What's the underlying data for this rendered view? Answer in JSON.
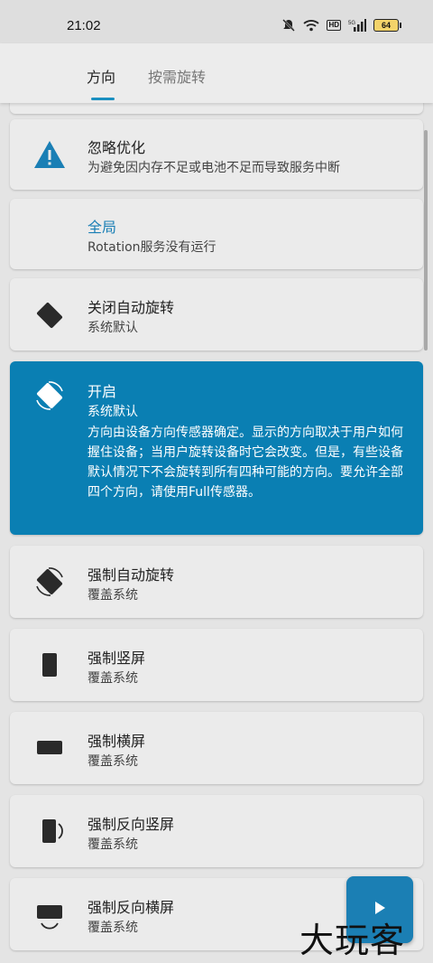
{
  "status_bar": {
    "time": "21:02",
    "battery": "64",
    "hd_badge": "HD",
    "icons": [
      "mute-icon",
      "wifi-icon",
      "hd-icon",
      "signal-icon",
      "battery-icon"
    ]
  },
  "tabs": [
    {
      "label": "方向",
      "active": true
    },
    {
      "label": "按需旋转",
      "active": false
    }
  ],
  "colors": {
    "accent": "#0a7fb3",
    "card_bg": "#ebebeb",
    "page_bg": "#e4e4e4",
    "warning_icon": "#1a7fb5"
  },
  "cards": [
    {
      "icon": "warning-icon",
      "title": "忽略优化",
      "subtitle": "为避免因内存不足或电池不足而导致服务中断"
    },
    {
      "icon": "",
      "title": "全局",
      "subtitle": "Rotation服务没有运行"
    },
    {
      "icon": "rotate-off-icon",
      "title": "关闭自动旋转",
      "subtitle": "系统默认"
    },
    {
      "icon": "rotate-on-icon",
      "title": "开启",
      "subtitle": "系统默认",
      "description": "方向由设备方向传感器确定。显示的方向取决于用户如何握住设备；当用户旋转设备时它会改变。但是，有些设备默认情况下不会旋转到所有四种可能的方向。要允许全部四个方向，请使用Full传感器。",
      "selected": true
    },
    {
      "icon": "force-auto-rotate-icon",
      "title": "强制自动旋转",
      "subtitle": "覆盖系统"
    },
    {
      "icon": "portrait-icon",
      "title": "强制竖屏",
      "subtitle": "覆盖系统"
    },
    {
      "icon": "landscape-icon",
      "title": "强制横屏",
      "subtitle": "覆盖系统"
    },
    {
      "icon": "reverse-portrait-icon",
      "title": "强制反向竖屏",
      "subtitle": "覆盖系统"
    },
    {
      "icon": "reverse-landscape-icon",
      "title": "强制反向横屏",
      "subtitle": "覆盖系统"
    }
  ],
  "fab": {
    "icon": "play-icon"
  },
  "watermark": "大玩客"
}
